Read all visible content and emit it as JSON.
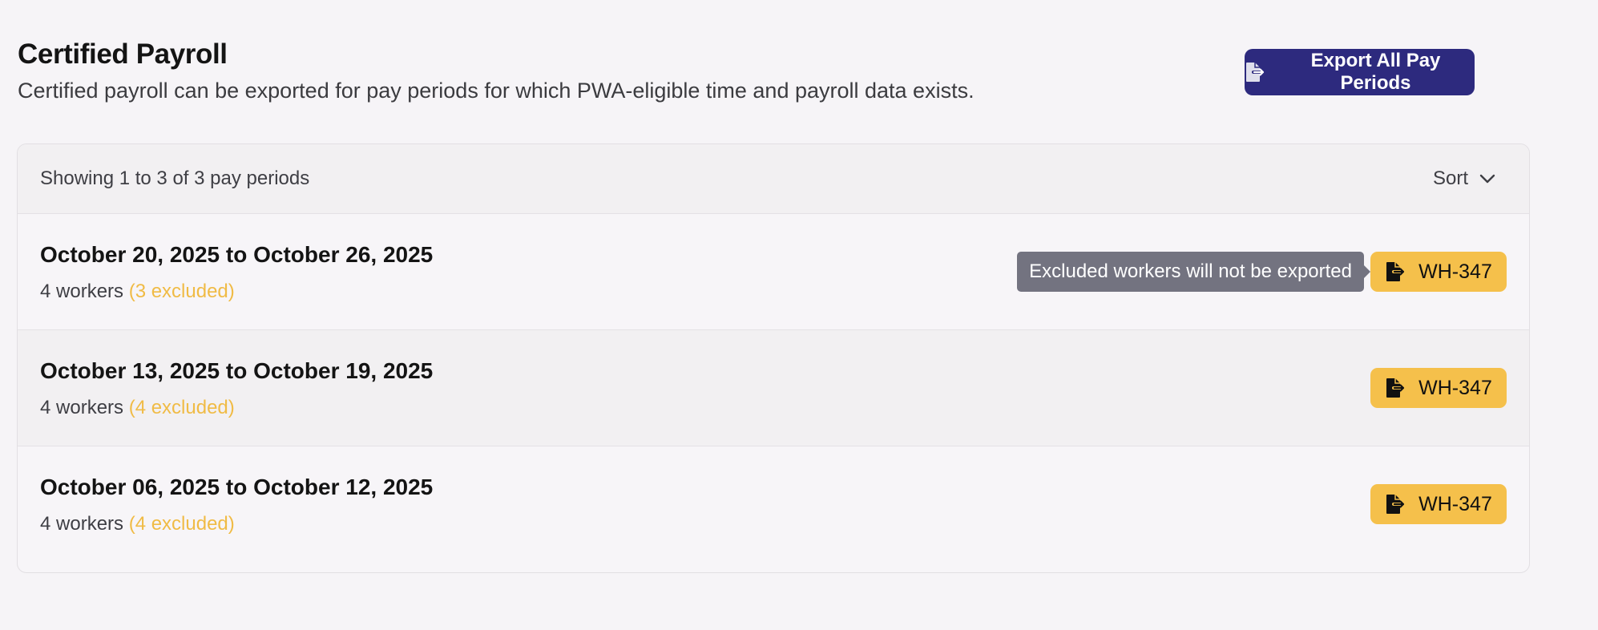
{
  "header": {
    "title": "Certified Payroll",
    "subtitle": "Certified payroll can be exported for pay periods for which PWA-eligible time and payroll data exists.",
    "export_all_label": "Export All Pay Periods",
    "export_all_icon": "file-export-icon"
  },
  "list": {
    "showing_text": "Showing 1 to 3 of 3 pay periods",
    "sort_label": "Sort",
    "sort_icon": "chevron-down-icon",
    "rows": [
      {
        "period": "October 20, 2025 to October 26, 2025",
        "workers": "4 workers",
        "excluded": "(3 excluded)",
        "button_label": "WH-347",
        "tooltip": "Excluded workers will not be exported"
      },
      {
        "period": "October 13, 2025 to October 19, 2025",
        "workers": "4 workers",
        "excluded": "(4 excluded)",
        "button_label": "WH-347"
      },
      {
        "period": "October 06, 2025 to October 12, 2025",
        "workers": "4 workers",
        "excluded": "(4 excluded)",
        "button_label": "WH-347"
      }
    ]
  },
  "colors": {
    "primary": "#2d2a7e",
    "warning": "#f5c04b",
    "excluded_text": "#f0bb45",
    "tooltip_bg": "#737380",
    "background": "#f6f4f7"
  }
}
